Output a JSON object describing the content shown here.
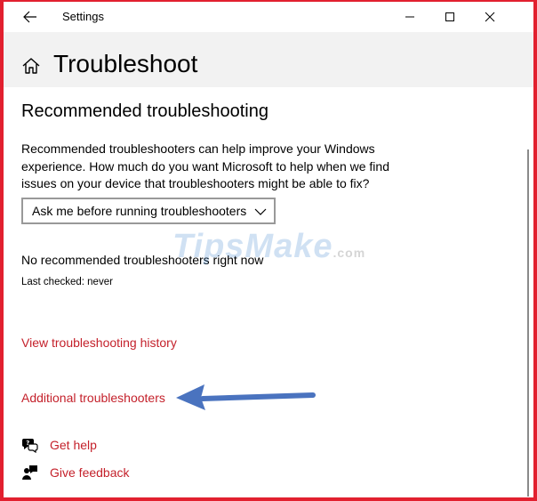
{
  "window": {
    "title": "Settings"
  },
  "header": {
    "page_title": "Troubleshoot"
  },
  "main": {
    "section_title": "Recommended troubleshooting",
    "description": "Recommended troubleshooters can help improve your Windows experience. How much do you want Microsoft to help when we find issues on your device that troubleshooters might be able to fix?",
    "dropdown": {
      "selected": "Ask me before running troubleshooters"
    },
    "status": "No recommended troubleshooters right now",
    "last_checked": "Last checked: never",
    "links": {
      "history": "View troubleshooting history",
      "additional": "Additional troubleshooters"
    },
    "help": {
      "get_help": "Get help",
      "give_feedback": "Give feedback"
    }
  },
  "watermark": {
    "brand": "TipsMake",
    "suffix": ".com"
  },
  "colors": {
    "accent_link": "#c4212b",
    "frame": "#e2202f",
    "header_bg": "#f2f2f2",
    "arrow": "#4a73bf"
  }
}
